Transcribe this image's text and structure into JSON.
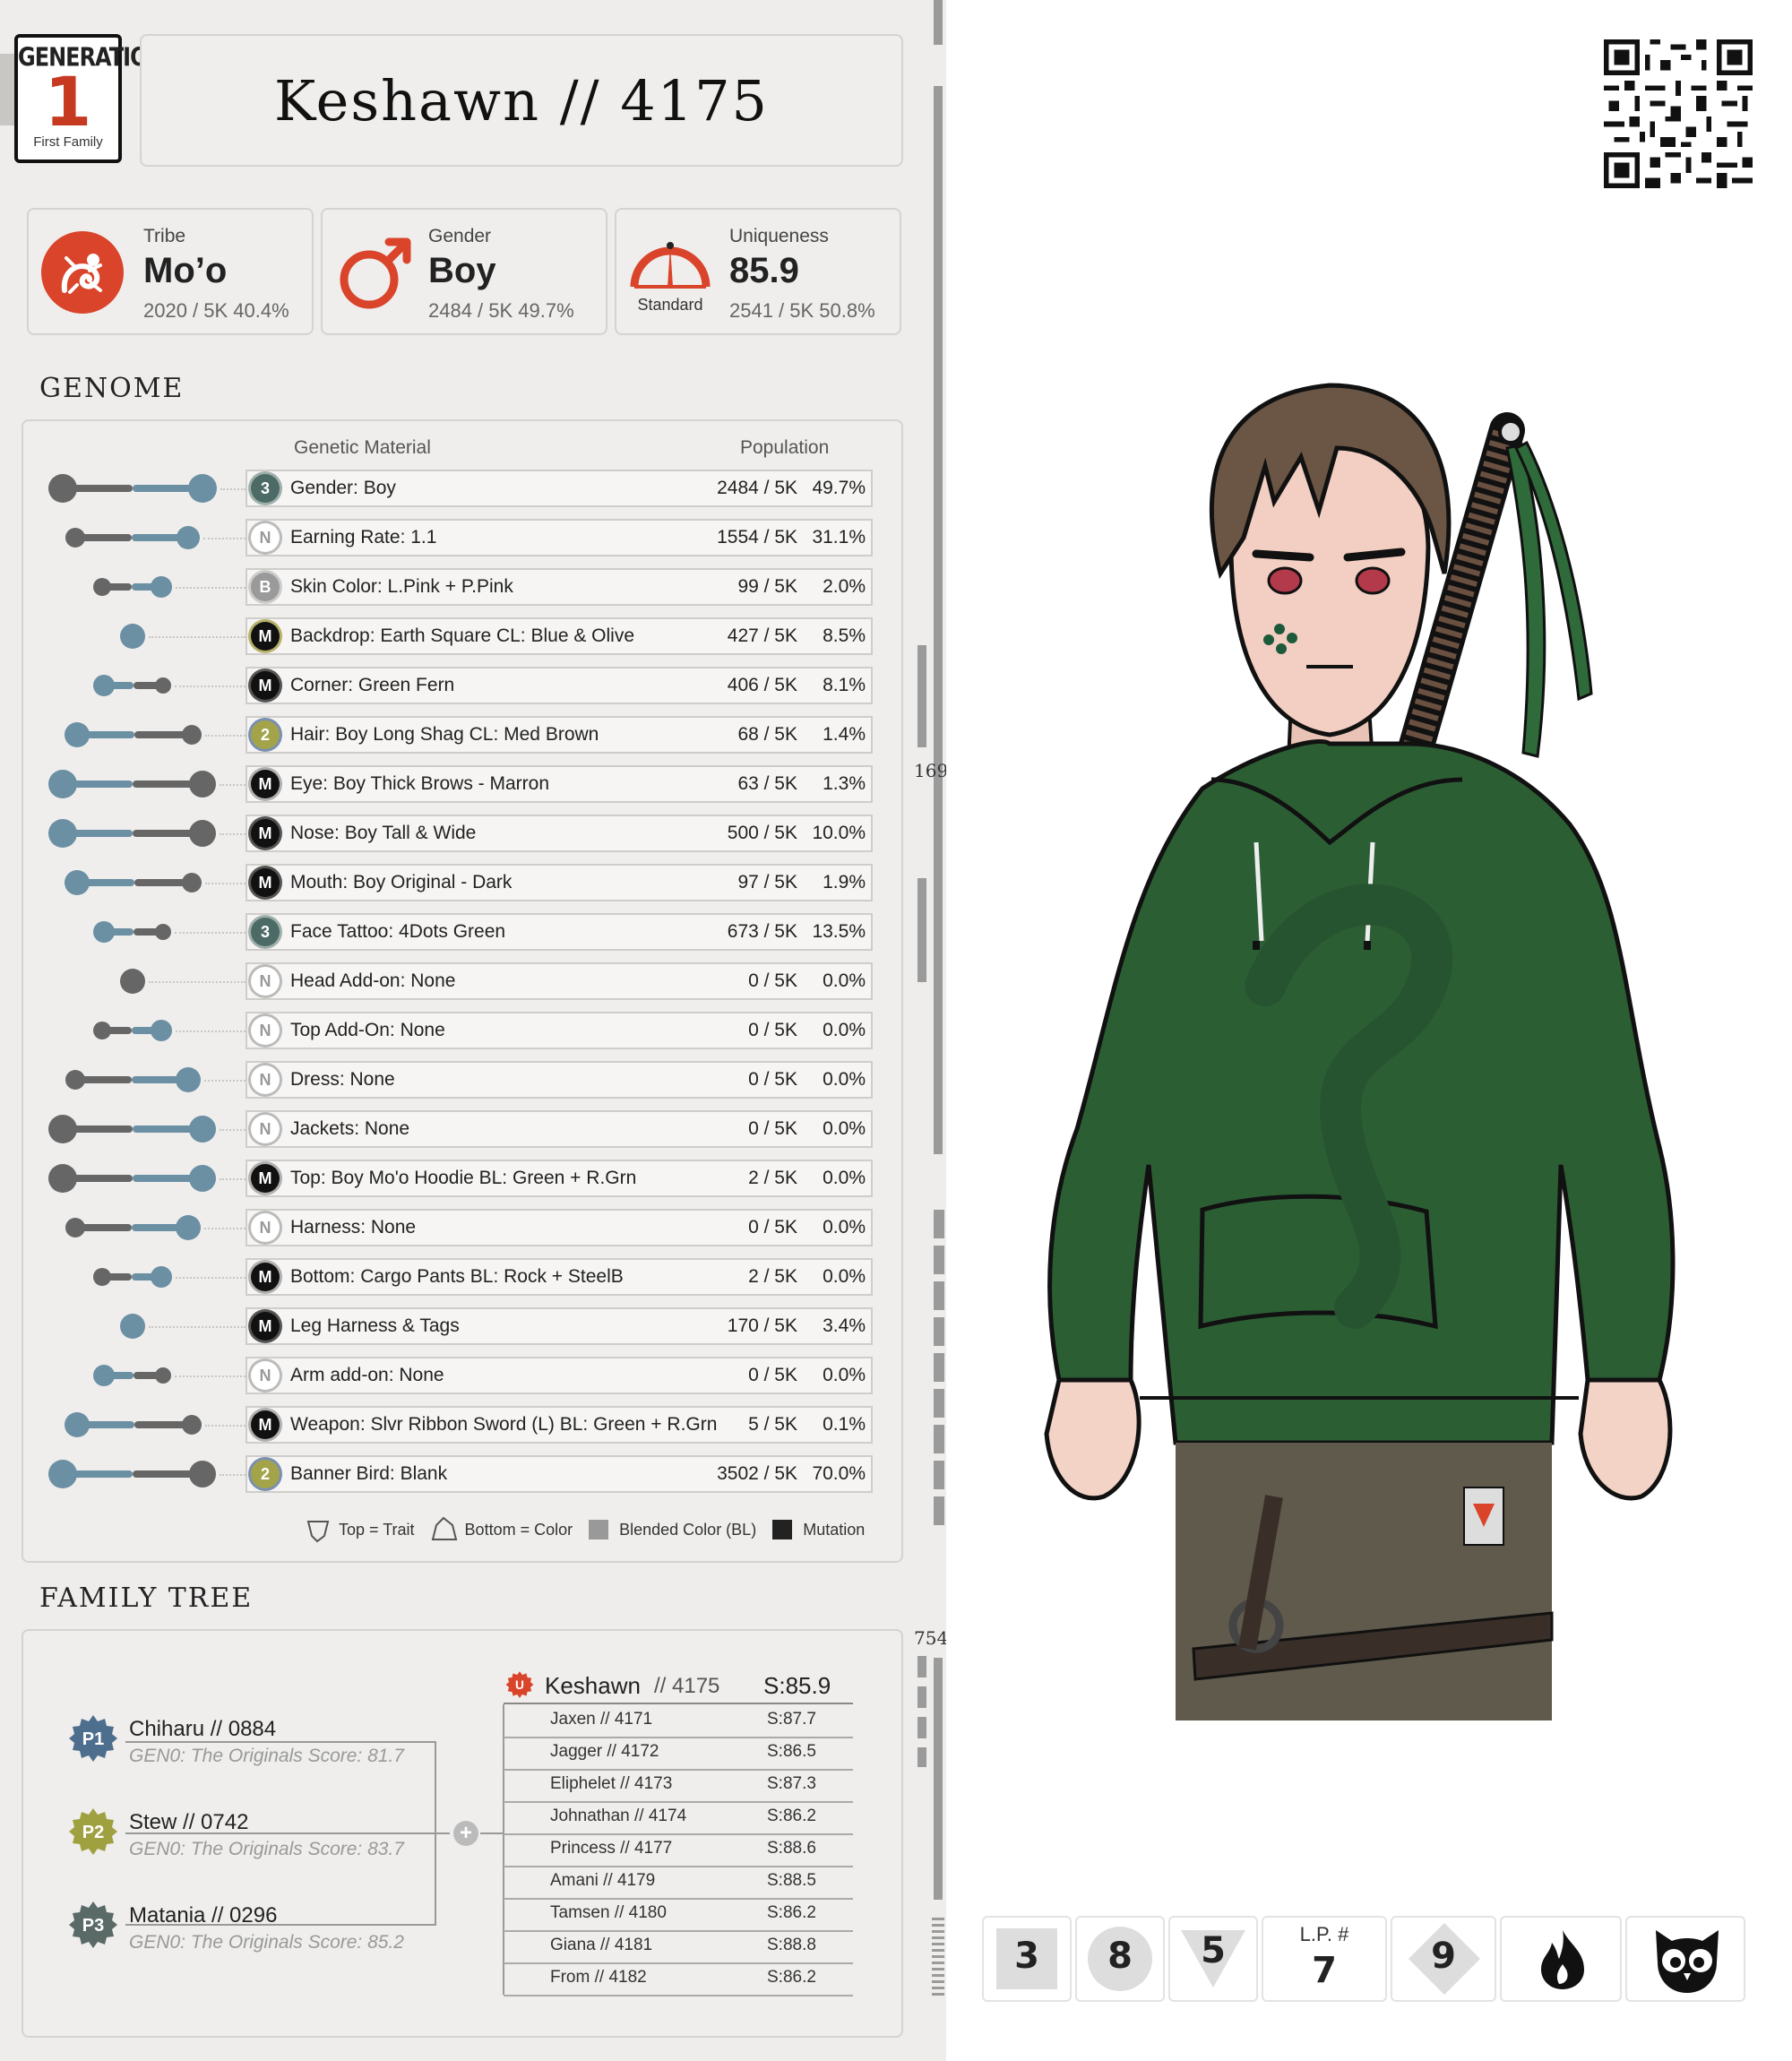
{
  "generation": {
    "top": "GENERATION",
    "number": "1",
    "caption": "First Family"
  },
  "title": "Keshawn  //  4175",
  "stats": [
    {
      "label": "Tribe",
      "value": "Mo’o",
      "sub": "2020 / 5K  40.4%",
      "icon": "salamander-icon",
      "color": "#d9442a"
    },
    {
      "label": "Gender",
      "value": "Boy",
      "sub": "2484 / 5K  49.7%",
      "icon": "male-symbol-icon",
      "color": "#d9442a"
    },
    {
      "label": "Uniqueness",
      "value": "85.9",
      "sub": "2541 / 5K  50.8%",
      "icon": "gauge-icon",
      "icon_caption": "Standard",
      "color": "#d9442a"
    }
  ],
  "genome": {
    "heading": "GENOME",
    "col_material": "Genetic Material",
    "col_population": "Population",
    "rows": [
      {
        "badge": "3",
        "badge_kind": "num",
        "name": "Gender: Boy",
        "count": "2484 / 5K",
        "pct": "49.7%"
      },
      {
        "badge": "N",
        "badge_kind": "n",
        "name": "Earning Rate: 1.1",
        "count": "1554 / 5K",
        "pct": "31.1%"
      },
      {
        "badge": "B",
        "badge_kind": "b",
        "name": "Skin Color: L.Pink + P.Pink",
        "count": "99 / 5K",
        "pct": "2.0%"
      },
      {
        "badge": "M",
        "badge_kind": "mixed",
        "name": "Backdrop: Earth Square CL: Blue & Olive",
        "count": "427 / 5K",
        "pct": "8.5%"
      },
      {
        "badge": "M",
        "badge_kind": "m",
        "name": "Corner: Green Fern",
        "count": "406 / 5K",
        "pct": "8.1%"
      },
      {
        "badge": "2",
        "badge_kind": "two",
        "name": "Hair: Boy Long Shag CL: Med Brown",
        "count": "68 / 5K",
        "pct": "1.4%"
      },
      {
        "badge": "M",
        "badge_kind": "mgrey",
        "name": "Eye: Boy Thick Brows - Marron",
        "count": "63 / 5K",
        "pct": "1.3%"
      },
      {
        "badge": "M",
        "badge_kind": "m",
        "name": "Nose: Boy Tall & Wide",
        "count": "500 / 5K",
        "pct": "10.0%"
      },
      {
        "badge": "M",
        "badge_kind": "m",
        "name": "Mouth: Boy Original - Dark",
        "count": "97 / 5K",
        "pct": "1.9%"
      },
      {
        "badge": "3",
        "badge_kind": "num",
        "name": "Face Tattoo: 4Dots Green",
        "count": "673 / 5K",
        "pct": "13.5%"
      },
      {
        "badge": "N",
        "badge_kind": "n",
        "name": "Head Add-on:  None",
        "count": "0 / 5K",
        "pct": "0.0%"
      },
      {
        "badge": "N",
        "badge_kind": "n",
        "name": "Top Add-On: None",
        "count": "0 / 5K",
        "pct": "0.0%"
      },
      {
        "badge": "N",
        "badge_kind": "n",
        "name": "Dress: None",
        "count": "0 / 5K",
        "pct": "0.0%"
      },
      {
        "badge": "N",
        "badge_kind": "n",
        "name": "Jackets: None",
        "count": "0 / 5K",
        "pct": "0.0%"
      },
      {
        "badge": "M",
        "badge_kind": "mgrey",
        "name": "Top: Boy Mo'o Hoodie BL: Green + R.Grn",
        "count": "2 / 5K",
        "pct": "0.0%"
      },
      {
        "badge": "N",
        "badge_kind": "n",
        "name": "Harness: None",
        "count": "0 / 5K",
        "pct": "0.0%"
      },
      {
        "badge": "M",
        "badge_kind": "mgrey",
        "name": "Bottom: Cargo Pants BL: Rock + SteelB",
        "count": "2 / 5K",
        "pct": "0.0%"
      },
      {
        "badge": "M",
        "badge_kind": "m",
        "name": "Leg Harness & Tags",
        "count": "170 / 5K",
        "pct": "3.4%"
      },
      {
        "badge": "N",
        "badge_kind": "n",
        "name": "Arm add-on: None",
        "count": "0 / 5K",
        "pct": "0.0%"
      },
      {
        "badge": "M",
        "badge_kind": "mgrey",
        "name": "Weapon: Slvr Ribbon Sword (L) BL: Green + R.Grn",
        "count": "5 / 5K",
        "pct": "0.1%"
      },
      {
        "badge": "2",
        "badge_kind": "two",
        "name": "Banner Bird:  Blank",
        "count": "3502 / 5K",
        "pct": "70.0%"
      }
    ],
    "legend": {
      "trait": "Top = Trait",
      "color": "Bottom = Color",
      "blended": "Blended Color (BL)",
      "mutation": "Mutation"
    }
  },
  "family": {
    "heading": "FAMILY TREE",
    "parents": [
      {
        "tag": "P1",
        "name": "Chiharu  //  0884",
        "sub": "GEN0: The Originals Score: 81.7",
        "color": "#4e6e8e"
      },
      {
        "tag": "P2",
        "name": "Stew  //  0742",
        "sub": "GEN0: The Originals Score: 83.7",
        "color": "#9fa040"
      },
      {
        "tag": "P3",
        "name": "Matania  //  0296",
        "sub": "GEN0: The Originals Score: 85.2",
        "color": "#5a6a66"
      }
    ],
    "self": {
      "badge": "U",
      "name": "Keshawn",
      "id": "// 4175",
      "score": "S:85.9"
    },
    "siblings": [
      {
        "name": "Jaxen  //  4171",
        "score": "S:87.7"
      },
      {
        "name": "Jagger  //  4172",
        "score": "S:86.5"
      },
      {
        "name": "Eliphelet  //  4173",
        "score": "S:87.3"
      },
      {
        "name": "Johnathan  //  4174",
        "score": "S:86.2"
      },
      {
        "name": "Princess  //  4177",
        "score": "S:88.6"
      },
      {
        "name": "Amani  //  4179",
        "score": "S:88.5"
      },
      {
        "name": "Tamsen  //  4180",
        "score": "S:86.2"
      },
      {
        "name": "Giana  //  4181",
        "score": "S:88.8"
      },
      {
        "name": "From  //  4182",
        "score": "S:86.2"
      }
    ]
  },
  "scroll_labels": {
    "mid": "169",
    "lower": "754"
  },
  "bottom_buttons": [
    {
      "value": "3",
      "shape": "square"
    },
    {
      "value": "8",
      "shape": "circle"
    },
    {
      "value": "5",
      "shape": "triangle"
    },
    {
      "label": "L.P. #",
      "value": "7"
    },
    {
      "value": "9",
      "shape": "diamond"
    },
    {
      "icon": "flame-icon"
    },
    {
      "icon": "owl-icon"
    }
  ],
  "colors": {
    "accent": "#d9442a",
    "slate": "#6b8fa3",
    "hoodie": "#2c5e34",
    "panel": "#eeedec"
  }
}
